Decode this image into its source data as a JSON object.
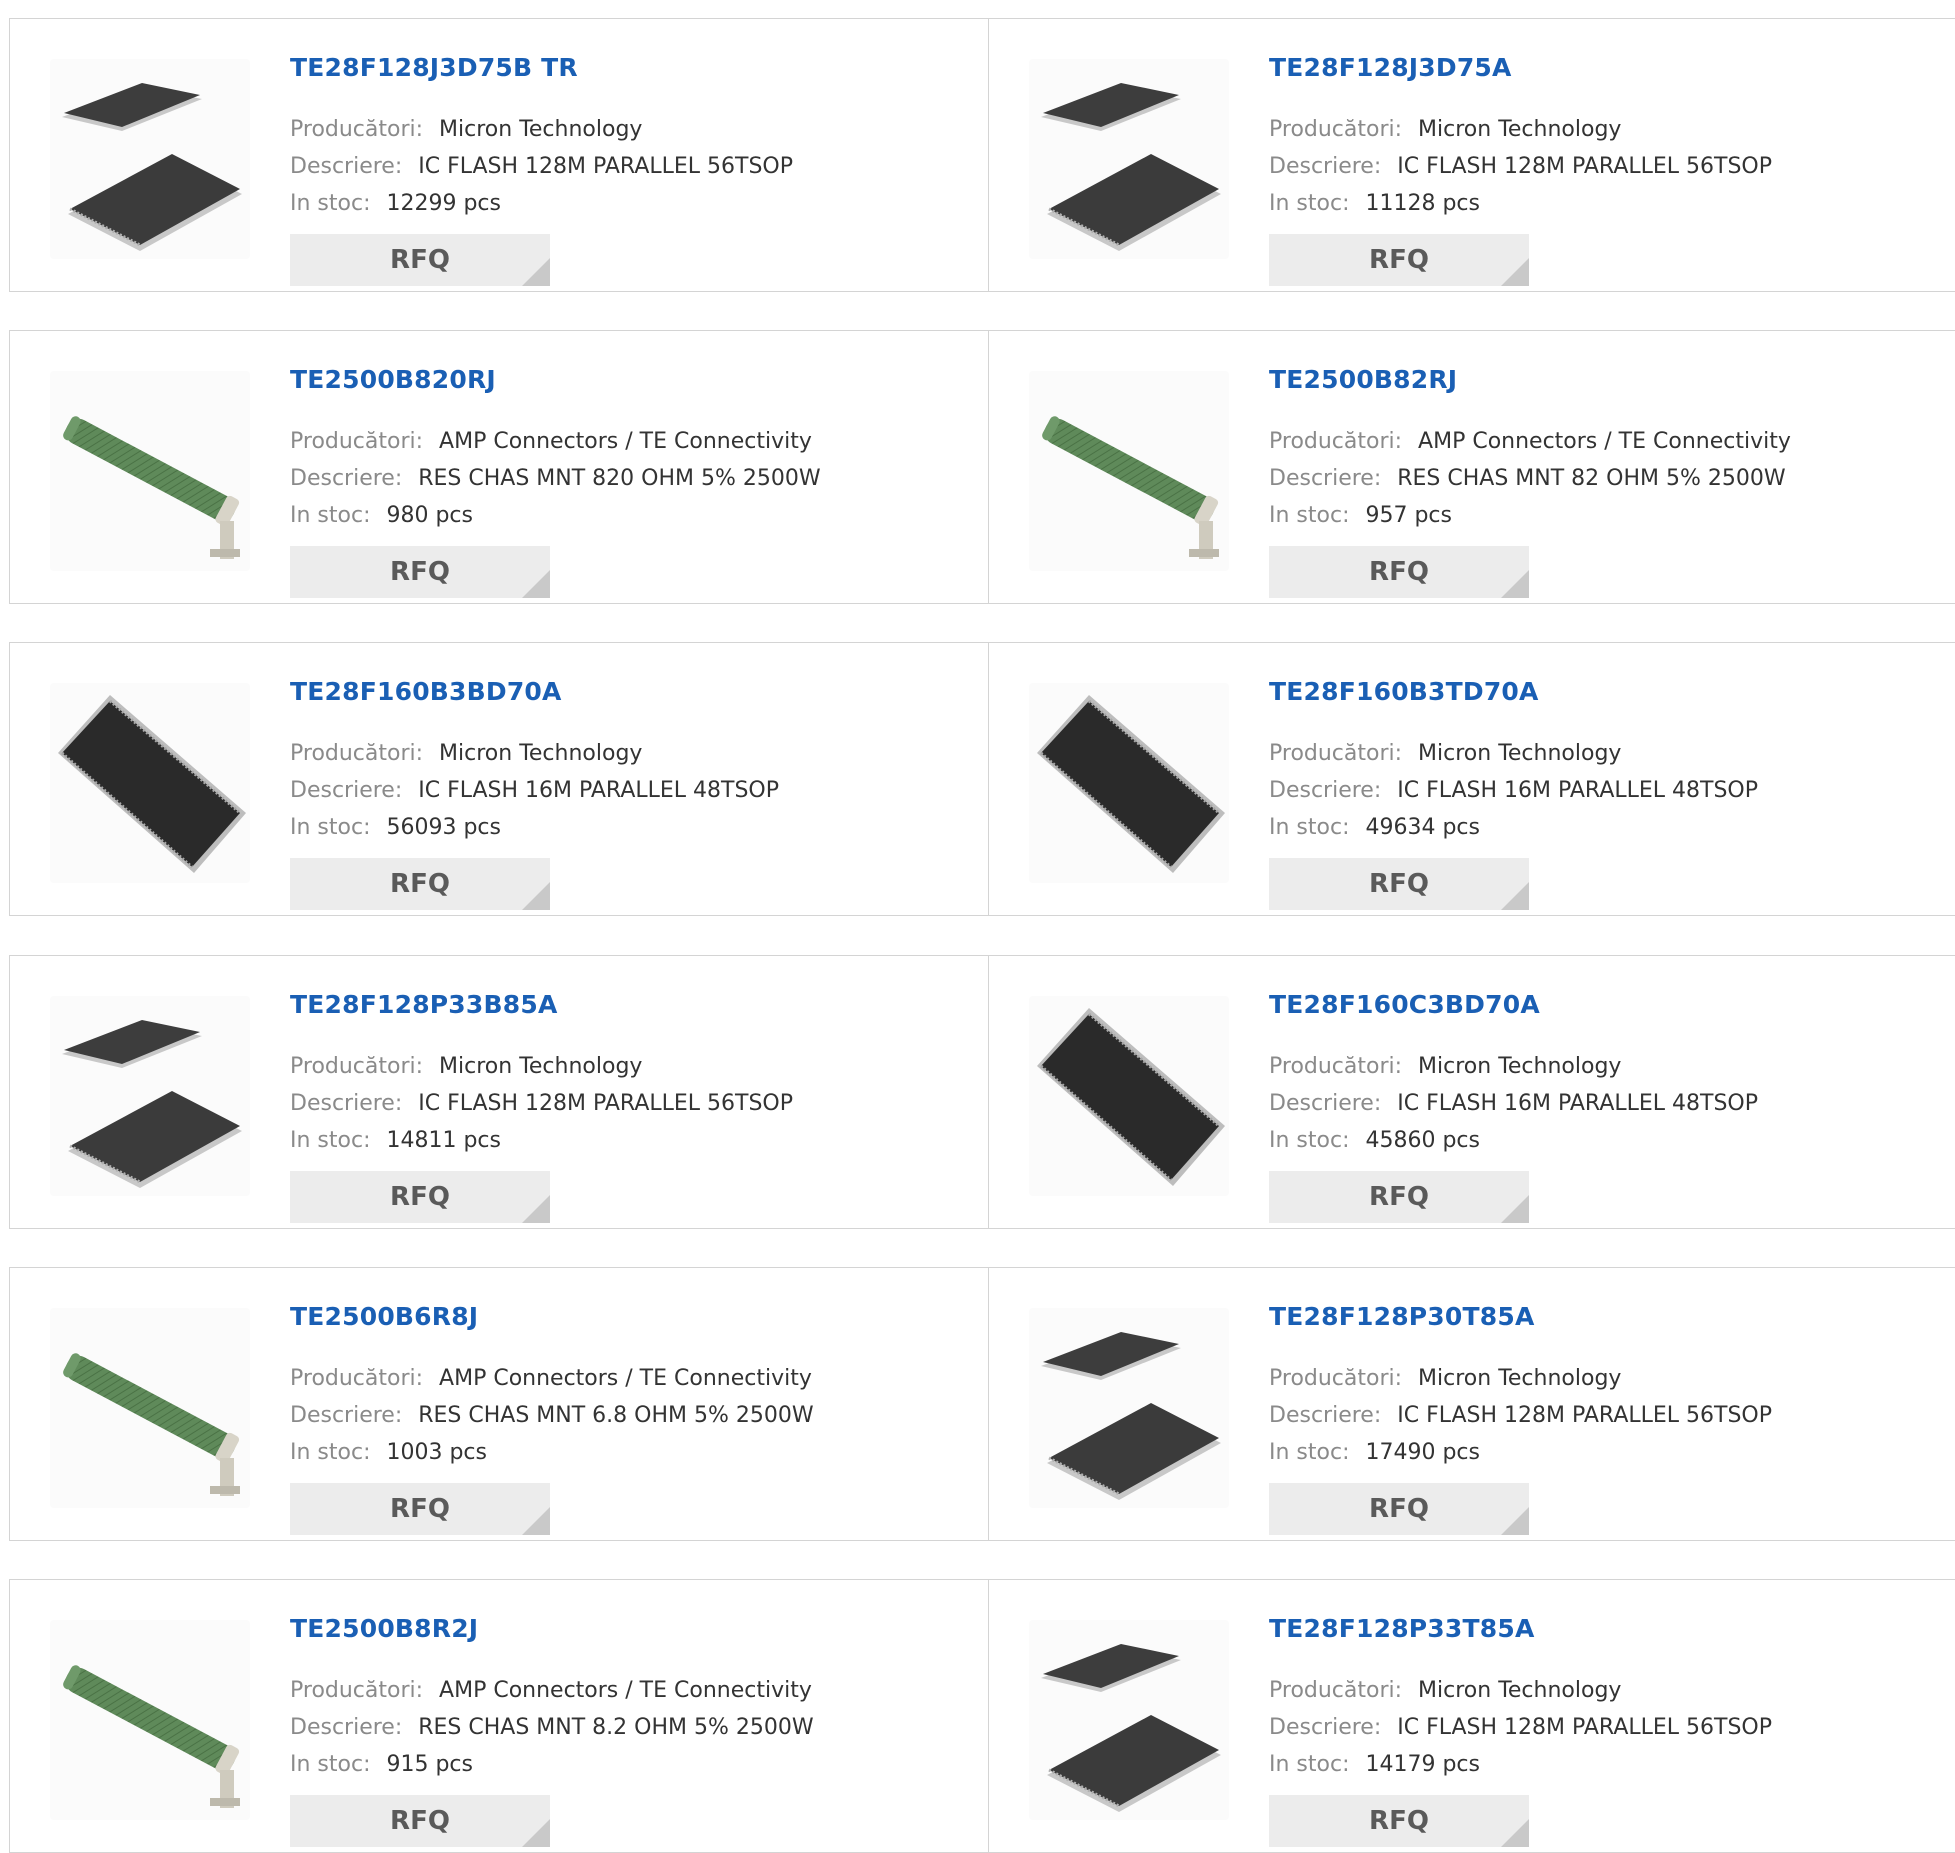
{
  "labels": {
    "manufacturer": "Producători:",
    "description": "Descriere:",
    "stock": "In stoc:",
    "rfq": "RFQ"
  },
  "products": [
    {
      "part": "TE28F128J3D75B TR",
      "manufacturer": "Micron Technology",
      "description": "IC FLASH 128M PARALLEL 56TSOP",
      "stock": "12299 pcs",
      "image": "tsop-56-chip-image"
    },
    {
      "part": "TE28F128J3D75A",
      "manufacturer": "Micron Technology",
      "description": "IC FLASH 128M PARALLEL 56TSOP",
      "stock": "11128 pcs",
      "image": "tsop-56-chip-image"
    },
    {
      "part": "TE2500B820RJ",
      "manufacturer": "AMP Connectors / TE Connectivity",
      "description": "RES CHAS MNT 820 OHM 5% 2500W",
      "stock": "980 pcs",
      "image": "resistor-image"
    },
    {
      "part": "TE2500B82RJ",
      "manufacturer": "AMP Connectors / TE Connectivity",
      "description": "RES CHAS MNT 82 OHM 5% 2500W",
      "stock": "957 pcs",
      "image": "resistor-image"
    },
    {
      "part": "TE28F160B3BD70A",
      "manufacturer": "Micron Technology",
      "description": "IC FLASH 16M PARALLEL 48TSOP",
      "stock": "56093 pcs",
      "image": "tsop-48-chip-image"
    },
    {
      "part": "TE28F160B3TD70A",
      "manufacturer": "Micron Technology",
      "description": "IC FLASH 16M PARALLEL 48TSOP",
      "stock": "49634 pcs",
      "image": "tsop-48-chip-image"
    },
    {
      "part": "TE28F128P33B85A",
      "manufacturer": "Micron Technology",
      "description": "IC FLASH 128M PARALLEL 56TSOP",
      "stock": "14811 pcs",
      "image": "tsop-56-chip-image"
    },
    {
      "part": "TE28F160C3BD70A",
      "manufacturer": "Micron Technology",
      "description": "IC FLASH 16M PARALLEL 48TSOP",
      "stock": "45860 pcs",
      "image": "tsop-48-chip-image"
    },
    {
      "part": "TE2500B6R8J",
      "manufacturer": "AMP Connectors / TE Connectivity",
      "description": "RES CHAS MNT 6.8 OHM 5% 2500W",
      "stock": "1003 pcs",
      "image": "resistor-image"
    },
    {
      "part": "TE28F128P30T85A",
      "manufacturer": "Micron Technology",
      "description": "IC FLASH 128M PARALLEL 56TSOP",
      "stock": "17490 pcs",
      "image": "tsop-56-chip-image"
    },
    {
      "part": "TE2500B8R2J",
      "manufacturer": "AMP Connectors / TE Connectivity",
      "description": "RES CHAS MNT 8.2 OHM 5% 2500W",
      "stock": "915 pcs",
      "image": "resistor-image"
    },
    {
      "part": "TE28F128P33T85A",
      "manufacturer": "Micron Technology",
      "description": "IC FLASH 128M PARALLEL 56TSOP",
      "stock": "14179 pcs",
      "image": "tsop-56-chip-image"
    }
  ],
  "colors": {
    "part_link": "#1a5fb4",
    "label": "#8a8a8a",
    "value": "#333333",
    "rfq_bg": "#ececec",
    "border": "#d4d4d4"
  }
}
